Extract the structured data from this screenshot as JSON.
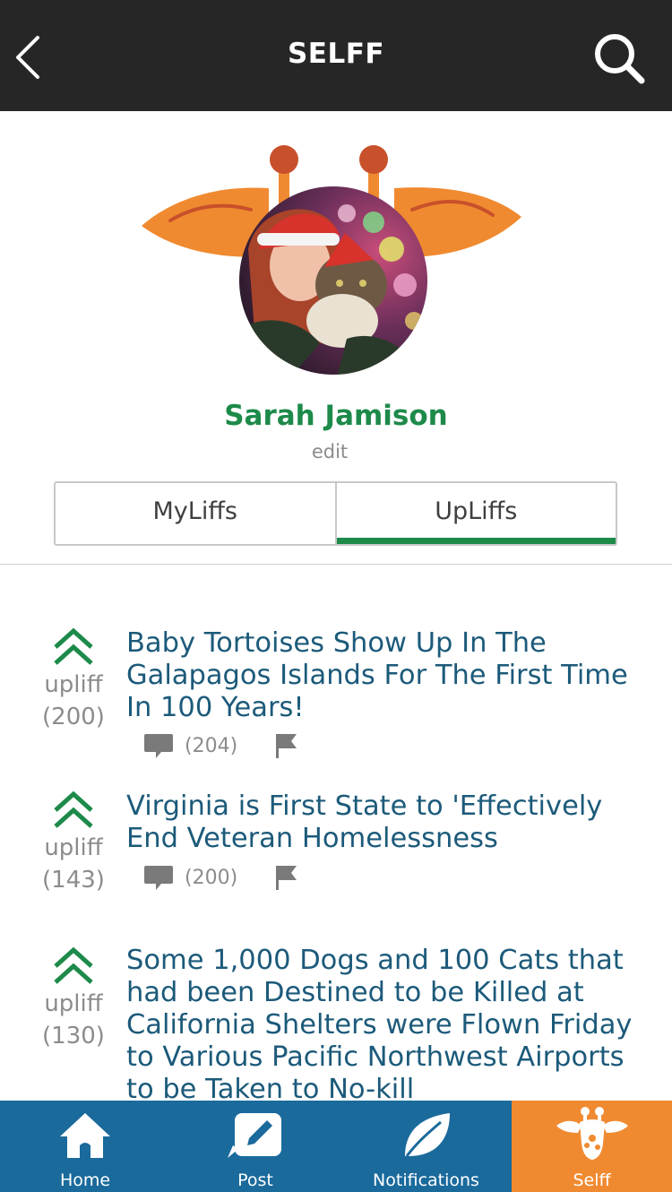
{
  "header": {
    "title": "SELFF"
  },
  "profile": {
    "name": "Sarah Jamison",
    "edit_label": "edit"
  },
  "tabs": [
    {
      "label": "MyLiffs",
      "active": false
    },
    {
      "label": "UpLiffs",
      "active": true
    }
  ],
  "feed": {
    "items": [
      {
        "vote_label": "upliff",
        "vote_count": "(200)",
        "headline": "Baby Tortoises Show Up In The Galapagos Islands For The First Time In 100 Years!",
        "comment_count": "(204)"
      },
      {
        "vote_label": "upliff",
        "vote_count": "(143)",
        "headline": "Virginia is First State to 'Effectively End Veteran Homelessness",
        "comment_count": "(200)"
      },
      {
        "vote_label": "upliff",
        "vote_count": "(130)",
        "headline": "Some 1,000 Dogs and 100 Cats that had been Destined to be Killed at California Shelters were Flown Friday to Various Pacific Northwest Airports to be Taken to No-kill"
      }
    ]
  },
  "bottom_nav": [
    {
      "label": "Home",
      "icon": "home-icon"
    },
    {
      "label": "Post",
      "icon": "pencil-icon"
    },
    {
      "label": "Notifications",
      "icon": "leaf-icon"
    },
    {
      "label": "Selff",
      "icon": "giraffe-icon",
      "active": true
    }
  ],
  "colors": {
    "header_bg": "#262626",
    "accent_green": "#1d8a4a",
    "headline_blue": "#1c5a7a",
    "nav_blue": "#1a6a9c",
    "nav_active_orange": "#f08a30"
  }
}
